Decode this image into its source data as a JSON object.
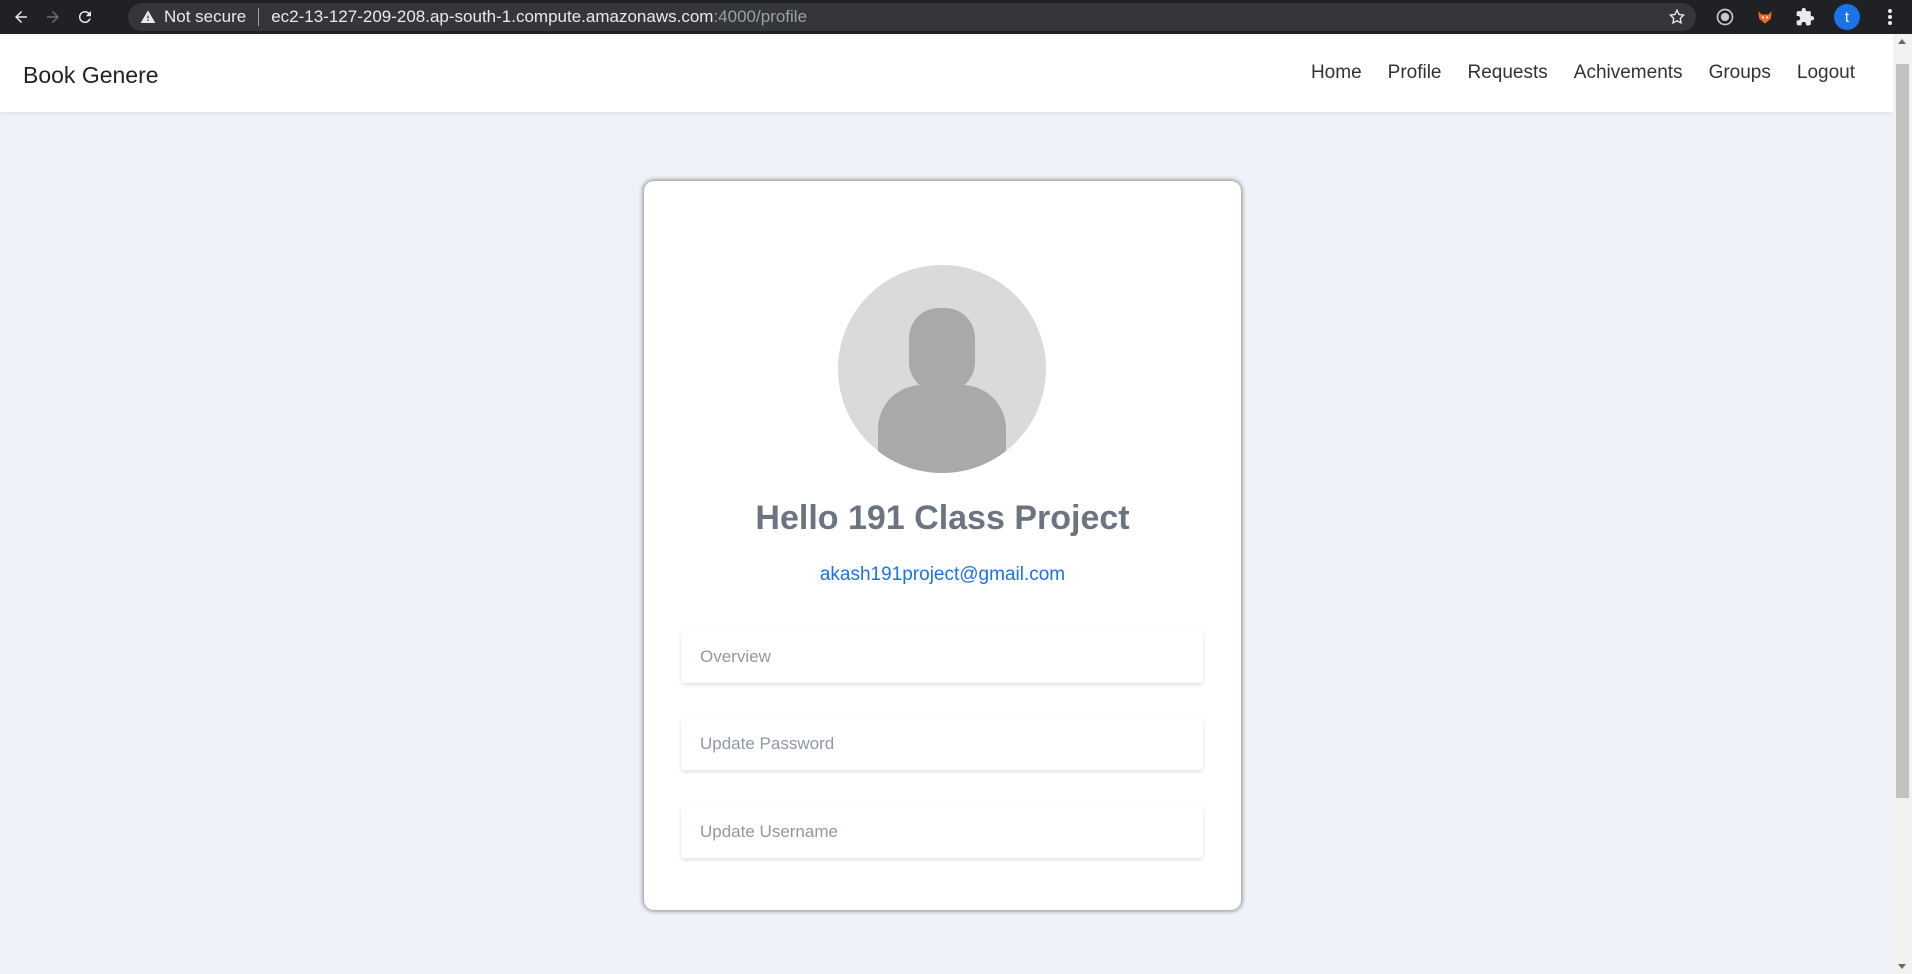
{
  "browser": {
    "security_label": "Not secure",
    "url_host": "ec2-13-127-209-208.ap-south-1.compute.amazonaws.com",
    "url_path": ":4000/profile",
    "profile_initial": "t"
  },
  "navbar": {
    "brand": "Book Genere",
    "links": [
      "Home",
      "Profile",
      "Requests",
      "Achivements",
      "Groups",
      "Logout"
    ]
  },
  "profile": {
    "greeting": "Hello 191 Class Project",
    "email": "akash191project@gmail.com",
    "options": [
      "Overview",
      "Update Password",
      "Update Username"
    ]
  },
  "colors": {
    "page_background": "#eff2f8",
    "link_blue": "#1a73e8",
    "heading_gray": "#6b7480"
  }
}
